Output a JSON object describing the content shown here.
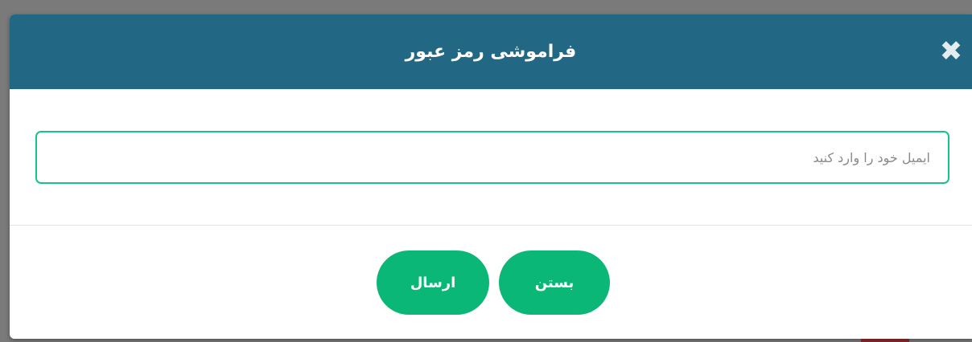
{
  "dialog": {
    "title": "فراموشی رمز عبور",
    "close_glyph": "✖",
    "email": {
      "placeholder": "ایمیل خود را وارد کنید",
      "value": ""
    },
    "buttons": {
      "send_label": "ارسال",
      "close_label": "بستن"
    }
  },
  "colors": {
    "header_bg": "#226783",
    "accent_green": "#0ab776",
    "input_border": "#16c48a"
  }
}
